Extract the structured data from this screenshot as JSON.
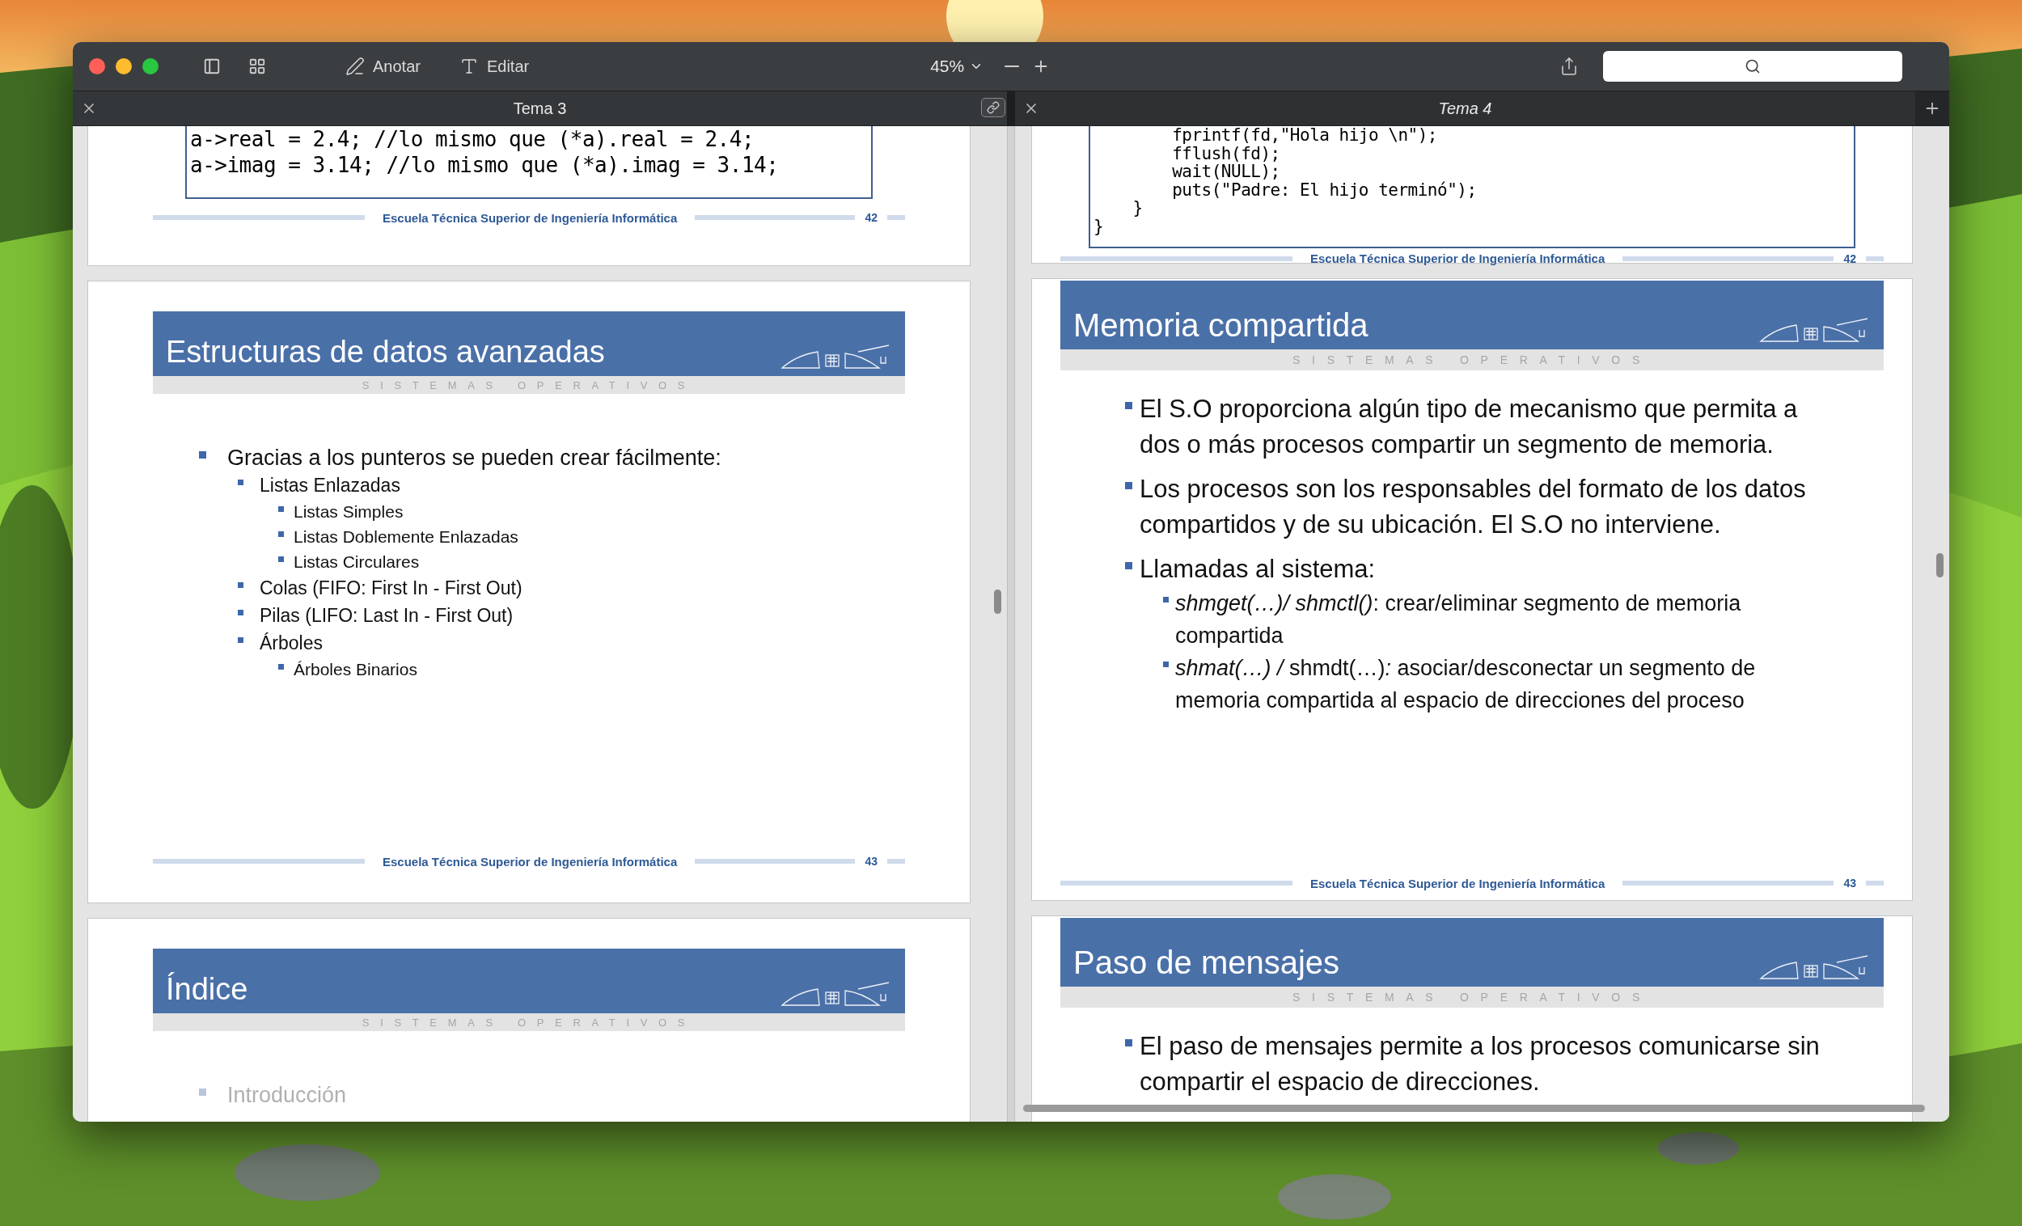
{
  "toolbar": {
    "tools": [
      {
        "kind": "annotate",
        "label": "Anotar"
      },
      {
        "kind": "edit",
        "label": "Editar"
      }
    ],
    "zoom": "45%"
  },
  "tabs": [
    {
      "label": "Tema 3",
      "selected": true
    },
    {
      "label": "Tema 4",
      "selected": false
    }
  ],
  "panes": [
    {
      "slides": [
        {
          "kind": "code",
          "code": [
            "a->real = 2.4; //lo mismo que (*a).real = 2.4;",
            "a->imag = 3.14; //lo mismo que (*a).imag = 3.14;"
          ],
          "footer": "Escuela Técnica Superior de Ingeniería Informática",
          "page": "42"
        },
        {
          "kind": "bullets",
          "title": "Estructuras de datos avanzadas",
          "subtitle": "SISTEMAS OPERATIVOS",
          "bullets": [
            {
              "text": "Gracias a los punteros se pueden crear fácilmente:",
              "dimmed": false,
              "children": [
                {
                  "text": "Listas Enlazadas",
                  "dimmed": false,
                  "children": [
                    {
                      "text": "Listas Simples",
                      "dimmed": false
                    },
                    {
                      "text": "Listas Doblemente Enlazadas",
                      "dimmed": false
                    },
                    {
                      "text": "Listas Circulares",
                      "dimmed": false
                    }
                  ]
                },
                {
                  "text": "Colas (FIFO: First In - First Out)",
                  "dimmed": false
                },
                {
                  "text": "Pilas (LIFO: Last In - First Out)",
                  "dimmed": false
                },
                {
                  "text": "Árboles",
                  "dimmed": false,
                  "children": [
                    {
                      "text": "Árboles Binarios",
                      "dimmed": false
                    }
                  ]
                }
              ]
            }
          ],
          "footer": "Escuela Técnica Superior de Ingeniería Informática",
          "page": "43"
        },
        {
          "kind": "bullets",
          "title": "Índice",
          "subtitle": "SISTEMAS OPERATIVOS",
          "bullets": [
            {
              "text": "Introducción",
              "dimmed": true
            }
          ]
        }
      ]
    },
    {
      "slides": [
        {
          "kind": "code",
          "code": [
            "        fprintf(fd,\"Hola hijo \\n\");",
            "        fflush(fd);",
            "        wait(NULL);",
            "        puts(\"Padre: El hijo terminó\");",
            "    }",
            "}"
          ],
          "footer": "Escuela Técnica Superior de Ingeniería Informática",
          "page": "42"
        },
        {
          "kind": "bullets",
          "title": "Memoria compartida",
          "subtitle": "SISTEMAS OPERATIVOS",
          "bullets": [
            {
              "text": "El S.O proporciona algún tipo de mecanismo que permita a dos o más procesos compartir un segmento de memoria.",
              "dimmed": false
            },
            {
              "text": "Los procesos son los responsables del formato de los datos compartidos y de su ubicación. El S.O no interviene.",
              "dimmed": false
            },
            {
              "text": "Llamadas al sistema:",
              "dimmed": false,
              "children": [
                {
                  "text": "*shmget(…)/ shmctl()*: crear/eliminar segmento de memoria compartida",
                  "dimmed": false
                },
                {
                  "text": "*shmat(…)* */* shmdt(…)*:* asociar/desconectar un segmento de memoria compartida al espacio de direcciones del proceso",
                  "dimmed": false
                }
              ]
            }
          ],
          "footer": "Escuela Técnica Superior de Ingeniería Informática",
          "page": "43"
        },
        {
          "kind": "bullets",
          "title": "Paso de mensajes",
          "subtitle": "SISTEMAS OPERATIVOS",
          "bullets": [
            {
              "text": "El paso de mensajes permite a los procesos comunicarse sin compartir el espacio de direcciones.",
              "dimmed": false
            }
          ]
        }
      ]
    }
  ]
}
